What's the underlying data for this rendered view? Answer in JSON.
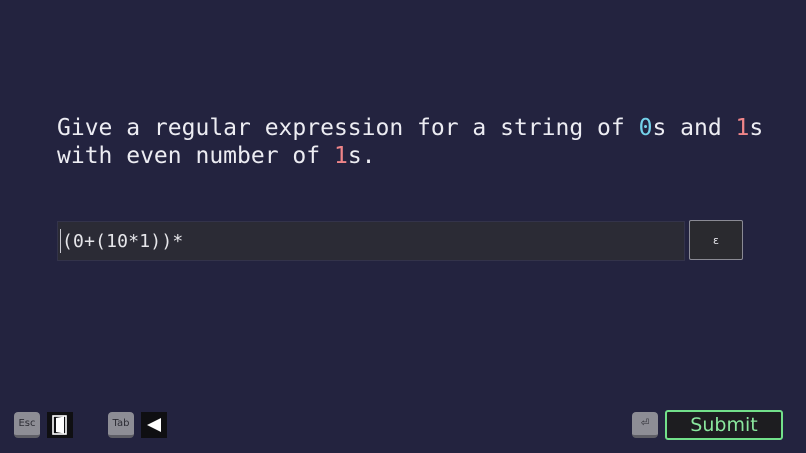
{
  "question": {
    "part1": "Give a regular expression for a string of ",
    "zero": "0",
    "part2": "s and ",
    "one_a": "1",
    "part3": "s with even number of ",
    "one_b": "1",
    "part4": "s."
  },
  "answer": {
    "value": "(0+(10*1))*"
  },
  "epsilon_button": {
    "label": "ε"
  },
  "controls": {
    "esc_key": "Esc",
    "tab_key": "Tab",
    "enter_key": "⏎",
    "submit_label": "Submit"
  },
  "colors": {
    "background": "#23233f",
    "zero_digit": "#74d2ea",
    "one_digit": "#ef8589",
    "submit_accent": "#72e08a"
  },
  "icons": {
    "exit": "exit-door-icon",
    "back": "back-arrow-icon",
    "enter": "enter-key-icon"
  }
}
